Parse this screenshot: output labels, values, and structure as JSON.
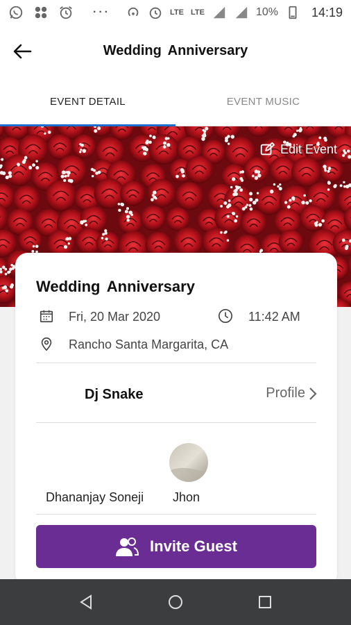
{
  "status_bar": {
    "battery": "10%",
    "time": "14:19",
    "network_1": "LTE",
    "network_2": "LTE",
    "more": "···"
  },
  "header": {
    "title": "Wedding  Anniversary",
    "back_icon": "arrow-left-icon"
  },
  "tabs": [
    {
      "label": "EVENT DETAIL",
      "active": true
    },
    {
      "label": "EVENT MUSIC",
      "active": false
    }
  ],
  "hero": {
    "edit_label": "Edit Event",
    "edit_icon": "edit-icon"
  },
  "event": {
    "name": "Wedding  Anniversary",
    "date": "Fri, 20 Mar 2020",
    "time": "11:42 AM",
    "location": "Rancho Santa Margarita, CA"
  },
  "dj": {
    "name": "Dj Snake",
    "profile_label": "Profile"
  },
  "guests": [
    {
      "name": "Dhananjay Soneji"
    },
    {
      "name": "Jhon"
    }
  ],
  "invite": {
    "label": "Invite Guest",
    "icon": "users-icon"
  },
  "colors": {
    "accent": "#6a2d94",
    "tab_indicator": "#1a6fd0",
    "nav_bar": "#3b3d3f"
  }
}
